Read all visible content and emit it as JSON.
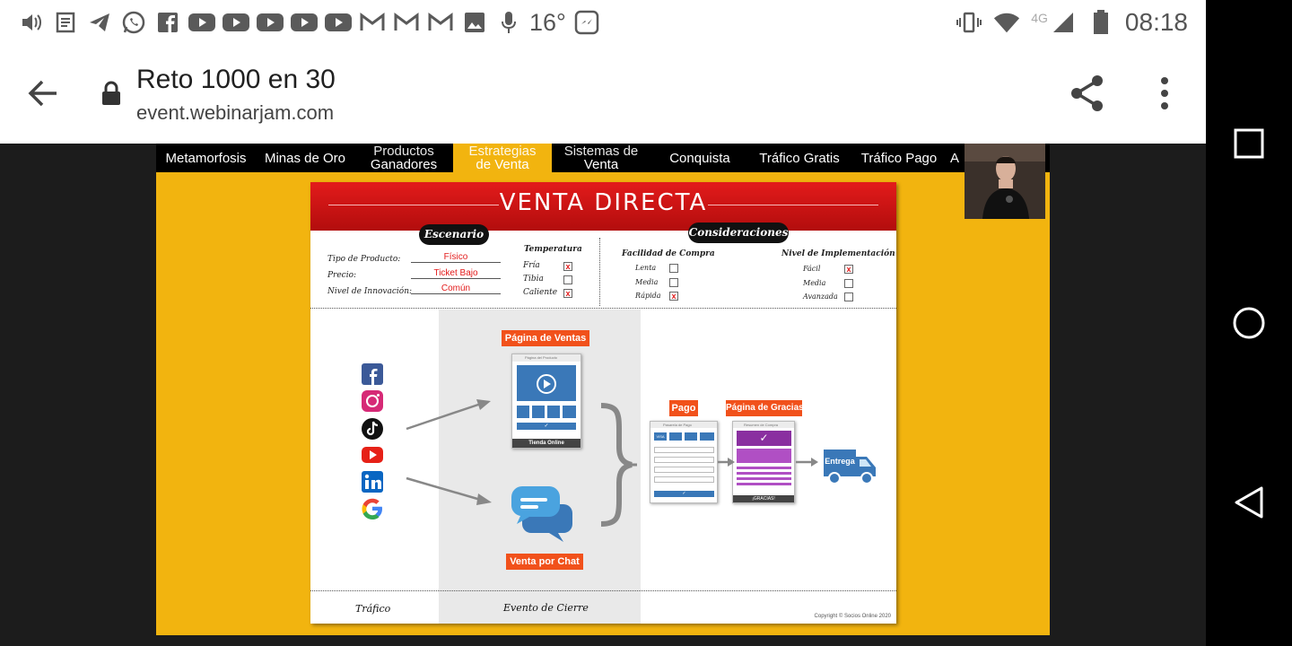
{
  "status_bar": {
    "temperature": "16°",
    "network": "4G",
    "time": "08:18",
    "left_icons": [
      "volume-icon",
      "notes-icon",
      "telegram-icon",
      "whatsapp-icon",
      "facebook-icon",
      "youtube-icon",
      "youtube-icon",
      "youtube-icon",
      "youtube-icon",
      "youtube-icon",
      "gmail-icon",
      "gmail-icon",
      "gmail-icon",
      "image-icon",
      "mic-icon",
      "weather-icon",
      "messenger-icon"
    ]
  },
  "browser": {
    "title": "Reto 1000 en 30",
    "url": "event.webinarjam.com"
  },
  "video": {
    "nav": [
      {
        "label": "Metamorfosis",
        "line2": ""
      },
      {
        "label": "Minas de Oro",
        "line2": ""
      },
      {
        "label": "Productos",
        "line2": "Ganadores"
      },
      {
        "label": "Estrategias",
        "line2": "de Venta",
        "active": true
      },
      {
        "label": "Sistemas de",
        "line2": "Venta"
      },
      {
        "label": "Conquista",
        "line2": ""
      },
      {
        "label": "Tráfico Gratis",
        "line2": ""
      },
      {
        "label": "Tráfico Pago",
        "line2": ""
      },
      {
        "label": "A",
        "line2": ""
      }
    ],
    "slide": {
      "title": "VENTA DIRECTA",
      "escenario": {
        "heading": "Escenario",
        "rows": [
          {
            "label": "Tipo de Producto:",
            "value": "Físico"
          },
          {
            "label": "Precio:",
            "value": "Ticket Bajo"
          },
          {
            "label": "Nivel de Innovación:",
            "value": "Común"
          }
        ],
        "temperatura": {
          "heading": "Temperatura",
          "options": [
            {
              "label": "Fría",
              "checked": true
            },
            {
              "label": "Tibia",
              "checked": false
            },
            {
              "label": "Caliente",
              "checked": true
            }
          ]
        }
      },
      "consideraciones": {
        "heading": "Consideraciones",
        "facilidad": {
          "heading": "Facilidad de Compra",
          "options": [
            {
              "label": "Lenta",
              "checked": false
            },
            {
              "label": "Media",
              "checked": false
            },
            {
              "label": "Rápida",
              "checked": true
            }
          ]
        },
        "implementacion": {
          "heading": "Nivel de Implementación",
          "options": [
            {
              "label": "Fácil",
              "checked": true
            },
            {
              "label": "Media",
              "checked": false
            },
            {
              "label": "Avanzada",
              "checked": false
            }
          ]
        }
      },
      "flow": {
        "pagina_ventas": "Página de Ventas",
        "browser_caption": "Página del Producto",
        "tienda_online": "Tienda Online",
        "venta_chat": "Venta por Chat",
        "pago": "Pago",
        "pago_caption": "Pasarela de Pago",
        "gracias": "Página de Gracias",
        "gracias_caption": "Resumen de Compra",
        "gracias_banner": "¡GRACIAS!",
        "entrega": "Entrega"
      },
      "social_icons": [
        "facebook-icon",
        "instagram-icon",
        "tiktok-icon",
        "youtube-icon",
        "linkedin-icon",
        "google-icon"
      ],
      "footer": {
        "trafico": "Tráfico",
        "evento": "Evento de Cierre",
        "copyright": "Copyright © Socios Online 2020"
      }
    }
  },
  "colors": {
    "accent_yellow": "#f2b40f",
    "slide_red": "#e31b1b",
    "label_orange": "#f1511b",
    "flow_blue": "#3a78b8",
    "flow_purple": "#b04fc4"
  }
}
